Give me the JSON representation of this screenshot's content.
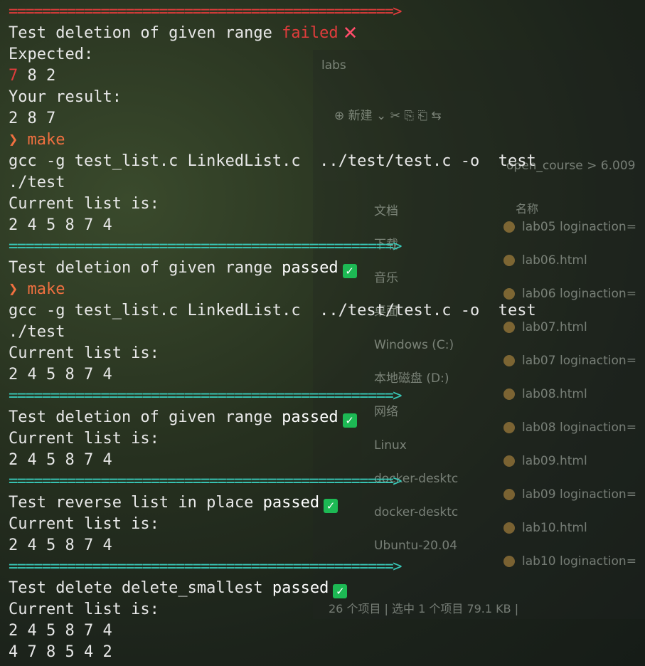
{
  "explorer": {
    "title": "labs",
    "toolbar": "⊕ 新建 ⌄    ✂    ⎘    ⎗    ⇆",
    "path": "open_course  >  6.009",
    "column_name": "名称",
    "sidebar": [
      "文档",
      "下载",
      "音乐",
      "桌面",
      "Windows (C:)",
      "本地磁盘 (D:)",
      "网络",
      "Linux",
      "docker-desktc",
      "docker-desktc",
      "Ubuntu-20.04"
    ],
    "files": [
      "lab05   loginaction=",
      "lab06.html",
      "lab06   loginaction=",
      "lab07.html",
      "lab07   loginaction=",
      "lab08.html",
      "lab08   loginaction=",
      "lab09.html",
      "lab09   loginaction=",
      "lab10.html",
      "lab10   loginaction="
    ],
    "status": "26 个项目  |  选中 1 个项目  79.1 KB  |"
  },
  "terminal": {
    "sep": "==============================================>",
    "b1": {
      "label": "Test deletion of given range",
      "status": "failed",
      "icon": "✕",
      "expected_label": "Expected:",
      "expected_first": "7",
      "expected_rest": " 8 2",
      "result_label": "Your result:",
      "result": "2 8 7"
    },
    "b2": {
      "prompt": "❯ make",
      "cmd": "gcc -g test_list.c LinkedList.c  ../test/test.c -o  test",
      "run": "./test",
      "list_label": "Current list is:",
      "list": "2 4 5 8 7 4",
      "test_label": "Test deletion of given range",
      "status": "passed"
    },
    "b3": {
      "prompt": "❯ make",
      "cmd": "gcc -g test_list.c LinkedList.c  ../test/test.c -o  test",
      "run": "./test",
      "list_label": "Current list is:",
      "list": "2 4 5 8 7 4",
      "test_label": "Test deletion of given range",
      "status": "passed"
    },
    "b4": {
      "list_label": "Current list is:",
      "list": "2 4 5 8 7 4",
      "test_label": "Test reverse list in place",
      "status": "passed"
    },
    "b5": {
      "list_label": "Current list is:",
      "list": "2 4 5 8 7 4",
      "test_label": "Test delete delete_smallest",
      "status": "passed"
    },
    "b6": {
      "list_label": "Current list is:",
      "list1": "2 4 5 8 7 4",
      "list2": "4 7 8 5 4 2"
    },
    "check_icon": "✓"
  }
}
